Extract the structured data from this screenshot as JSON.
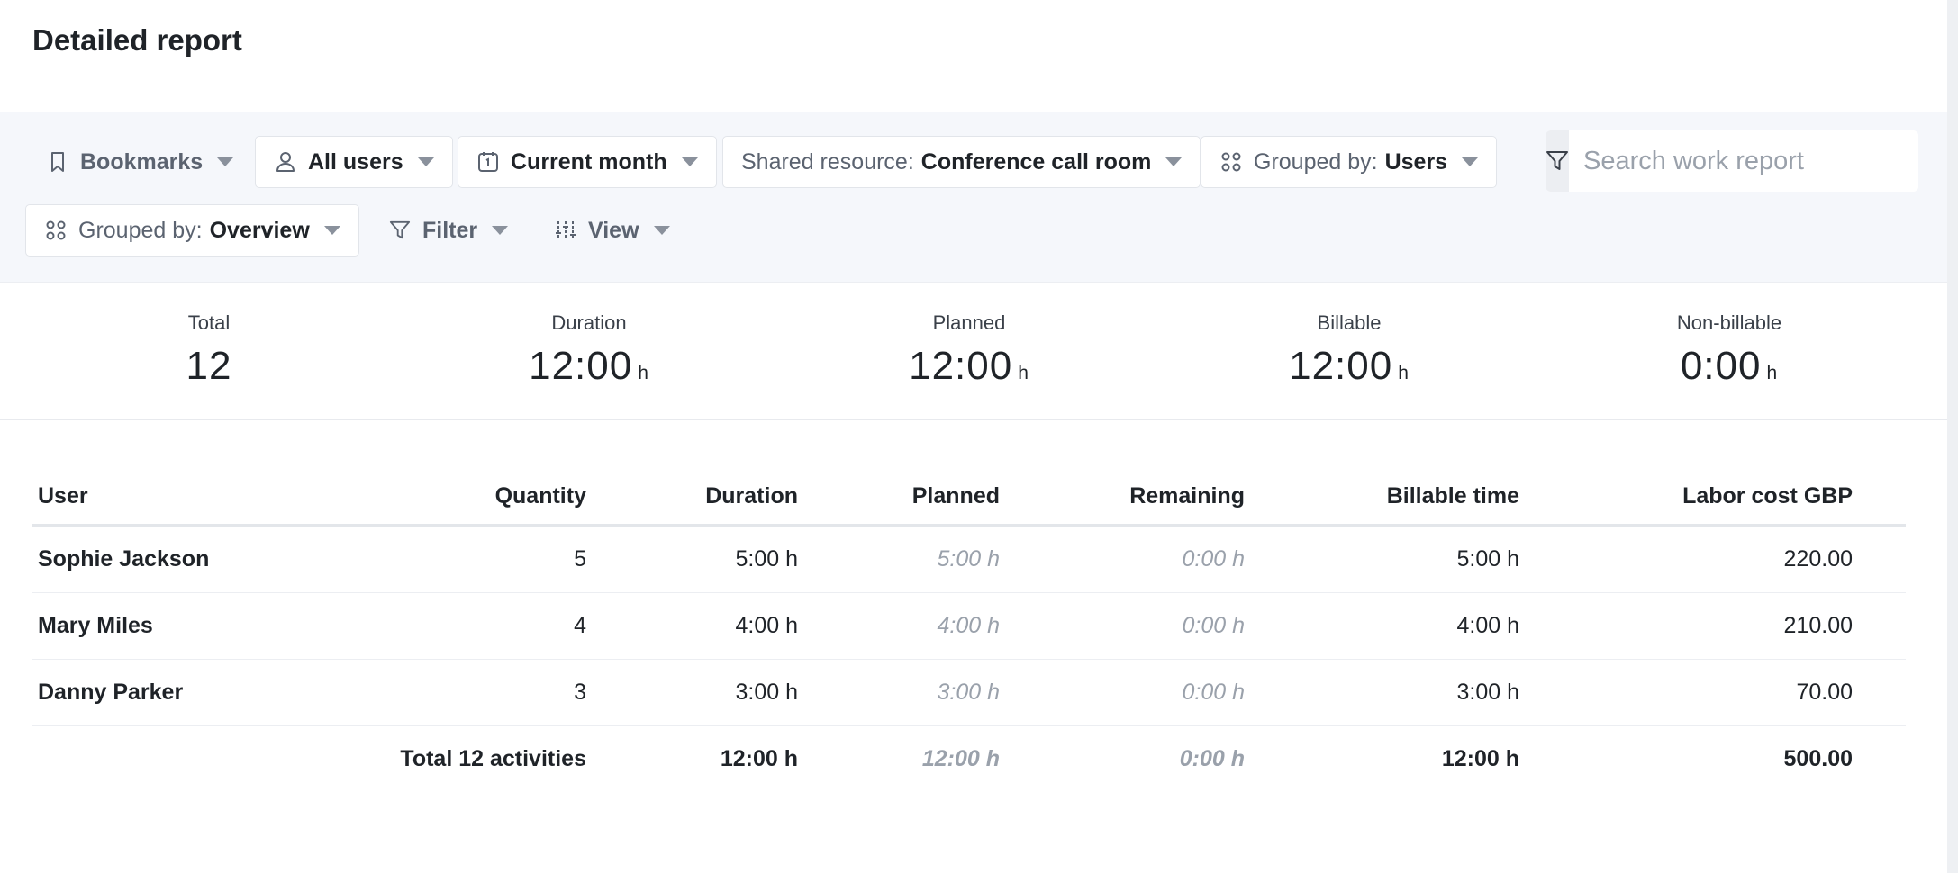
{
  "page": {
    "title": "Detailed report"
  },
  "filters": {
    "bookmarks": {
      "label": "Bookmarks"
    },
    "users": {
      "value": "All users"
    },
    "period": {
      "value": "Current month"
    },
    "resource": {
      "label": "Shared resource:",
      "value": "Conference call room"
    },
    "group1": {
      "label": "Grouped by:",
      "value": "Users"
    },
    "group2": {
      "label": "Grouped by:",
      "value": "Overview"
    },
    "filter": {
      "label": "Filter"
    },
    "view": {
      "label": "View"
    }
  },
  "search": {
    "placeholder": "Search work report",
    "value": ""
  },
  "summary": [
    {
      "label": "Total",
      "value": "12",
      "unit": ""
    },
    {
      "label": "Duration",
      "value": "12:00",
      "unit": "h"
    },
    {
      "label": "Planned",
      "value": "12:00",
      "unit": "h"
    },
    {
      "label": "Billable",
      "value": "12:00",
      "unit": "h"
    },
    {
      "label": "Non-billable",
      "value": "0:00",
      "unit": "h"
    }
  ],
  "table": {
    "columns": [
      "User",
      "Quantity",
      "Duration",
      "Planned",
      "Remaining",
      "Billable time",
      "Labor cost GBP"
    ],
    "rows": [
      {
        "user": "Sophie Jackson",
        "quantity": "5",
        "duration": "5:00 h",
        "planned": "5:00 h",
        "remaining": "0:00 h",
        "billable": "5:00 h",
        "cost": "220.00"
      },
      {
        "user": "Mary Miles",
        "quantity": "4",
        "duration": "4:00 h",
        "planned": "4:00 h",
        "remaining": "0:00 h",
        "billable": "4:00 h",
        "cost": "210.00"
      },
      {
        "user": "Danny Parker",
        "quantity": "3",
        "duration": "3:00 h",
        "planned": "3:00 h",
        "remaining": "0:00 h",
        "billable": "3:00 h",
        "cost": "70.00"
      }
    ],
    "total": {
      "label": "Total 12 activities",
      "duration": "12:00 h",
      "planned": "12:00 h",
      "remaining": "0:00 h",
      "billable": "12:00 h",
      "cost": "500.00"
    }
  }
}
